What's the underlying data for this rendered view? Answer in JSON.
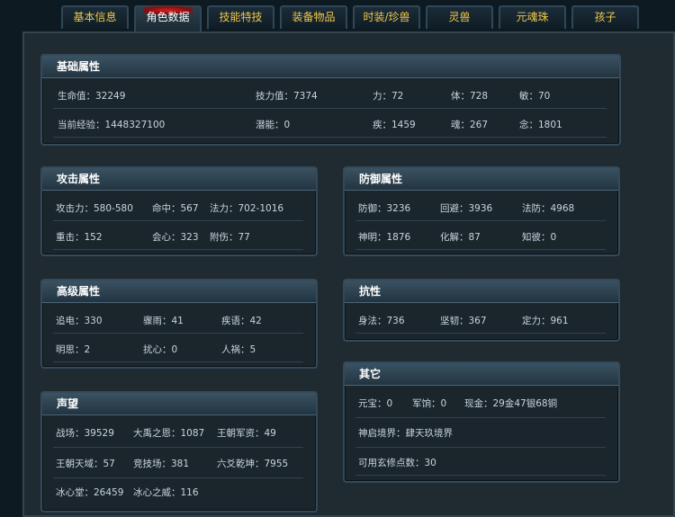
{
  "tabs": [
    {
      "label": "基本信息"
    },
    {
      "label": "角色数据"
    },
    {
      "label": "技能特技"
    },
    {
      "label": "装备物品"
    },
    {
      "label": "时装/珍兽"
    },
    {
      "label": "灵兽"
    },
    {
      "label": "元魂珠"
    },
    {
      "label": "孩子"
    }
  ],
  "active_tab": "角色数据",
  "basic": {
    "title": "基础属性",
    "hp": "生命值：32249",
    "skill_points": "技力值：7374",
    "str": "力：72",
    "con": "体：728",
    "agi": "敏：70",
    "exp": "当前经验：1448327100",
    "potential": "潜能：0",
    "dex": "疾：1459",
    "soul": "魂：267",
    "mind": "念：1801"
  },
  "attack": {
    "title": "攻击属性",
    "atk": "攻击力：580-580",
    "hit": "命中：567",
    "magic": "法力：702-1016",
    "heavy": "重击：152",
    "crit": "会心：323",
    "extra": "附伤：77"
  },
  "defense": {
    "title": "防御属性",
    "def": "防御：3236",
    "dodge": "回避：3936",
    "mdef": "法防：4968",
    "shenming": "神明：1876",
    "resolve": "化解：87",
    "zhibi": "知彼：0"
  },
  "advanced": {
    "title": "高级属性",
    "zhuidian": "追电：330",
    "zhouyu": "骤雨：41",
    "jiyu": "疾语：42",
    "mingsi": "明思：2",
    "raoxin": "扰心：0",
    "renhuo": "人祸：5"
  },
  "resist": {
    "title": "抗性",
    "shenfa": "身法：736",
    "jianren": "坚韧：367",
    "dingli": "定力：961"
  },
  "reputation": {
    "title": "声望",
    "zhanchang": "战场：39529",
    "dayu": "大禹之恩：1087",
    "wangchao_jun": "王朝军资：49",
    "wangchao_tian": "王朝天域：57",
    "jingji": "竞技场：381",
    "liuyao": "六爻乾坤：7955",
    "bingxin_tang": "冰心堂：26459",
    "bingxin_wei": "冰心之威：116"
  },
  "other": {
    "title": "其它",
    "yuanbao": "元宝：0",
    "junxiang": "军饷：0",
    "cash": "现金：29金47银68铜",
    "shenqi": "神启境界：肆天玖境界",
    "xuanxiu": "可用玄修点数：30"
  },
  "colors": {
    "tab_text": "#f0c84a",
    "header_bg": "#2f4554",
    "panel_bg": "#1f2a31",
    "accent_red": "#d61f1f"
  }
}
